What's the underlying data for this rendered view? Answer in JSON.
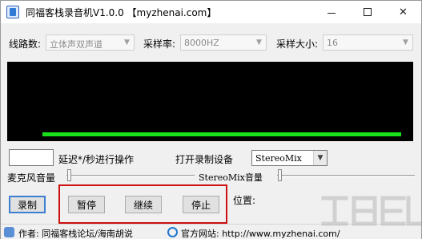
{
  "window": {
    "title": "同福客栈录音机V1.0.0 【myzhenai.com】",
    "controls": {
      "minimize": "minimize-icon",
      "maximize": "maximize-icon",
      "close_glyph": "✕"
    }
  },
  "settings": {
    "channels_label": "线路数:",
    "channels_value": "立体声双声道",
    "sample_rate_label": "采样率:",
    "sample_rate_value": "8000HZ",
    "sample_size_label": "采样大小:",
    "sample_size_value": "16"
  },
  "display": {
    "wave_color": "#19e019",
    "background": "#000000"
  },
  "delay": {
    "value": "",
    "label": "延迟*/秒进行操作"
  },
  "device": {
    "label": "打开录制设备",
    "value": "StereoMix"
  },
  "volume": {
    "mic_label": "麦克风音量",
    "stereo_label": "StereoMix音量"
  },
  "buttons": {
    "record": "录制",
    "pause": "暂停",
    "resume": "继续",
    "stop": "停止"
  },
  "position": {
    "label": "位置:"
  },
  "statusbar": {
    "author": "作者: 同福客栈论坛/海南胡说",
    "website": "官方网站: http://www.myzhenai.com/"
  },
  "colors": {
    "highlight_box": "#cc1010",
    "accent": "#3c7fd1"
  }
}
